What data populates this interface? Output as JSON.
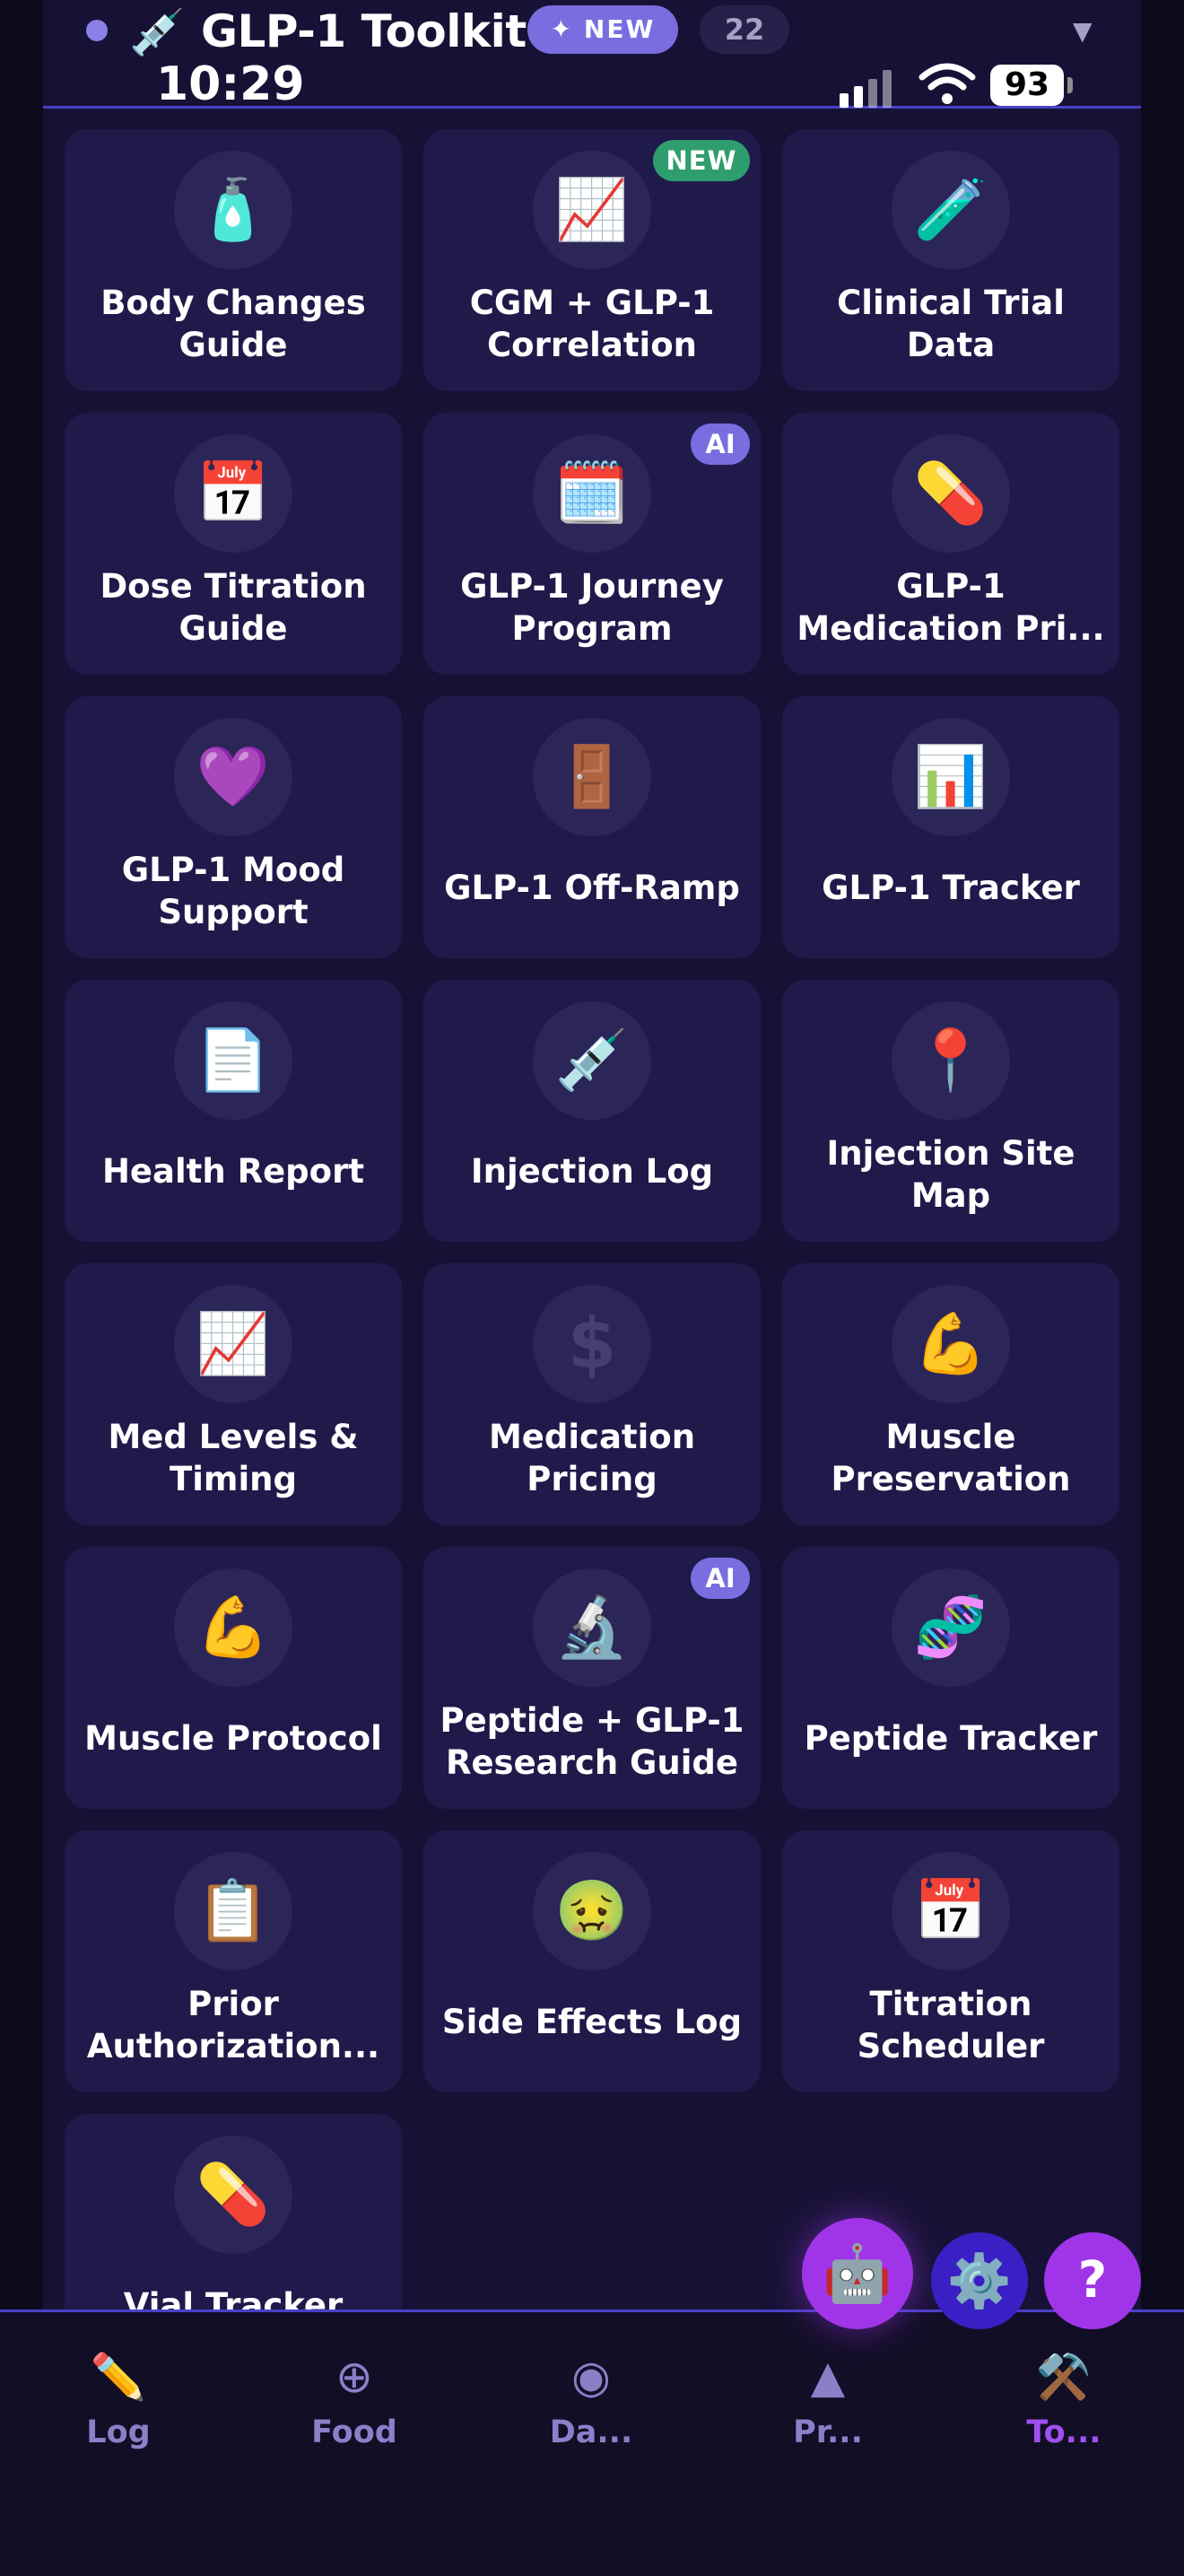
{
  "header": {
    "title_icon": "syringe-icon",
    "title": "GLP-1 Toolkit",
    "new_badge": "✦ NEW",
    "count_badge": "22",
    "dropdown_icon": "caret-down-icon"
  },
  "status_bar": {
    "time": "10:29",
    "battery": "93"
  },
  "tools": [
    {
      "label": "Body Changes Guide",
      "icon": "lotion-bottle-icon",
      "glyph": "🧴"
    },
    {
      "label": "CGM + GLP-1 Correlation",
      "icon": "chart-increasing-icon",
      "glyph": "📈",
      "badge": "NEW"
    },
    {
      "label": "Clinical Trial Data",
      "icon": "test-tube-icon",
      "glyph": "🧪"
    },
    {
      "label": "Dose Titration Guide",
      "icon": "calendar-icon",
      "glyph": "📅"
    },
    {
      "label": "GLP-1 Journey Program",
      "icon": "spiral-calendar-icon",
      "glyph": "🗓️",
      "badge": "AI"
    },
    {
      "label": "GLP-1 Medication Pri...",
      "icon": "pill-icon",
      "glyph": "💊"
    },
    {
      "label": "GLP-1 Mood Support",
      "icon": "purple-heart-icon",
      "glyph": "💜"
    },
    {
      "label": "GLP-1 Off-Ramp",
      "icon": "door-icon",
      "glyph": "🚪"
    },
    {
      "label": "GLP-1 Tracker",
      "icon": "bar-chart-icon",
      "glyph": "📊"
    },
    {
      "label": "Health Report",
      "icon": "document-icon",
      "glyph": "📄"
    },
    {
      "label": "Injection Log",
      "icon": "syringe-icon",
      "glyph": "💉"
    },
    {
      "label": "Injection Site Map",
      "icon": "round-pushpin-icon",
      "glyph": "📍"
    },
    {
      "label": "Med Levels & Timing",
      "icon": "chart-increasing-icon",
      "glyph": "📈"
    },
    {
      "label": "Medication Pricing",
      "icon": "dollar-sign-icon",
      "glyph": "$"
    },
    {
      "label": "Muscle Preservation",
      "icon": "flexed-biceps-icon",
      "glyph": "💪"
    },
    {
      "label": "Muscle Protocol",
      "icon": "flexed-biceps-icon",
      "glyph": "💪"
    },
    {
      "label": "Peptide + GLP-1 Research Guide",
      "icon": "microscope-icon",
      "glyph": "🔬",
      "badge": "AI"
    },
    {
      "label": "Peptide Tracker",
      "icon": "dna-icon",
      "glyph": "🧬"
    },
    {
      "label": "Prior Authorization...",
      "icon": "clipboard-icon",
      "glyph": "📋"
    },
    {
      "label": "Side Effects Log",
      "icon": "nauseated-face-icon",
      "glyph": "🤢"
    },
    {
      "label": "Titration Scheduler",
      "icon": "calendar-icon",
      "glyph": "📅"
    },
    {
      "label": "Vial Tracker",
      "icon": "pill-icon",
      "glyph": "💊"
    }
  ],
  "fabs": {
    "assistant_icon": "robot-icon",
    "assistant_glyph": "🤖",
    "settings_icon": "gear-icon",
    "settings_glyph": "⚙️",
    "help_icon": "question-mark-icon",
    "help_glyph": "?"
  },
  "tabs": [
    {
      "label": "Log",
      "icon": "pencil-icon",
      "glyph": "✏️"
    },
    {
      "label": "Food",
      "icon": "plus-circle-icon",
      "glyph": "⊕"
    },
    {
      "label": "Da...",
      "icon": "record-circle-icon",
      "glyph": "◉"
    },
    {
      "label": "Pr...",
      "icon": "triangle-icon",
      "glyph": "▲"
    },
    {
      "label": "To...",
      "icon": "hammer-pick-icon",
      "glyph": "⚒️",
      "active": true
    }
  ],
  "colors": {
    "background": "#0c0a1c",
    "panel": "#171235",
    "card": "#201a4a",
    "accent_purple": "#a034e8",
    "badge_new": "#2f9e6e",
    "badge_ai": "#7a6de0",
    "tab_active": "#a050f0",
    "tab_inactive": "#8a80c8"
  }
}
